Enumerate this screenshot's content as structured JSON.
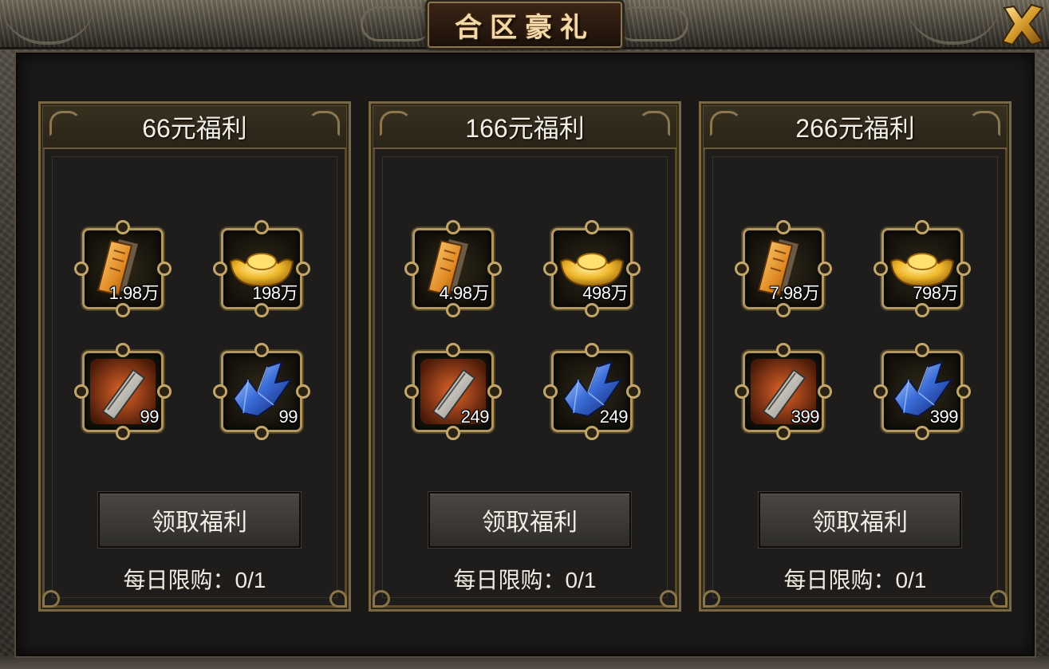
{
  "window": {
    "title": "合区豪礼"
  },
  "icons": {
    "close": "close-x-icon",
    "ticket": "gold-ticket-icon",
    "ingot": "gold-ingot-icon",
    "stone": "whetstone-icon",
    "crystal": "blue-crystal-icon"
  },
  "colors": {
    "title_gold": "#f2d9a8",
    "frame_gold": "#b09860",
    "panel_bg": "#1e1d1b",
    "button_bg": "#3b3935"
  },
  "packages": [
    {
      "title": "66元福利",
      "items": [
        {
          "icon": "gold-ticket-icon",
          "count": "1.98万"
        },
        {
          "icon": "gold-ingot-icon",
          "count": "198万"
        },
        {
          "icon": "whetstone-icon",
          "count": "99"
        },
        {
          "icon": "blue-crystal-icon",
          "count": "99"
        }
      ],
      "claim_label": "领取福利",
      "limit_text": "每日限购：0/1"
    },
    {
      "title": "166元福利",
      "items": [
        {
          "icon": "gold-ticket-icon",
          "count": "4.98万"
        },
        {
          "icon": "gold-ingot-icon",
          "count": "498万"
        },
        {
          "icon": "whetstone-icon",
          "count": "249"
        },
        {
          "icon": "blue-crystal-icon",
          "count": "249"
        }
      ],
      "claim_label": "领取福利",
      "limit_text": "每日限购：0/1"
    },
    {
      "title": "266元福利",
      "items": [
        {
          "icon": "gold-ticket-icon",
          "count": "7.98万"
        },
        {
          "icon": "gold-ingot-icon",
          "count": "798万"
        },
        {
          "icon": "whetstone-icon",
          "count": "399"
        },
        {
          "icon": "blue-crystal-icon",
          "count": "399"
        }
      ],
      "claim_label": "领取福利",
      "limit_text": "每日限购：0/1"
    }
  ]
}
